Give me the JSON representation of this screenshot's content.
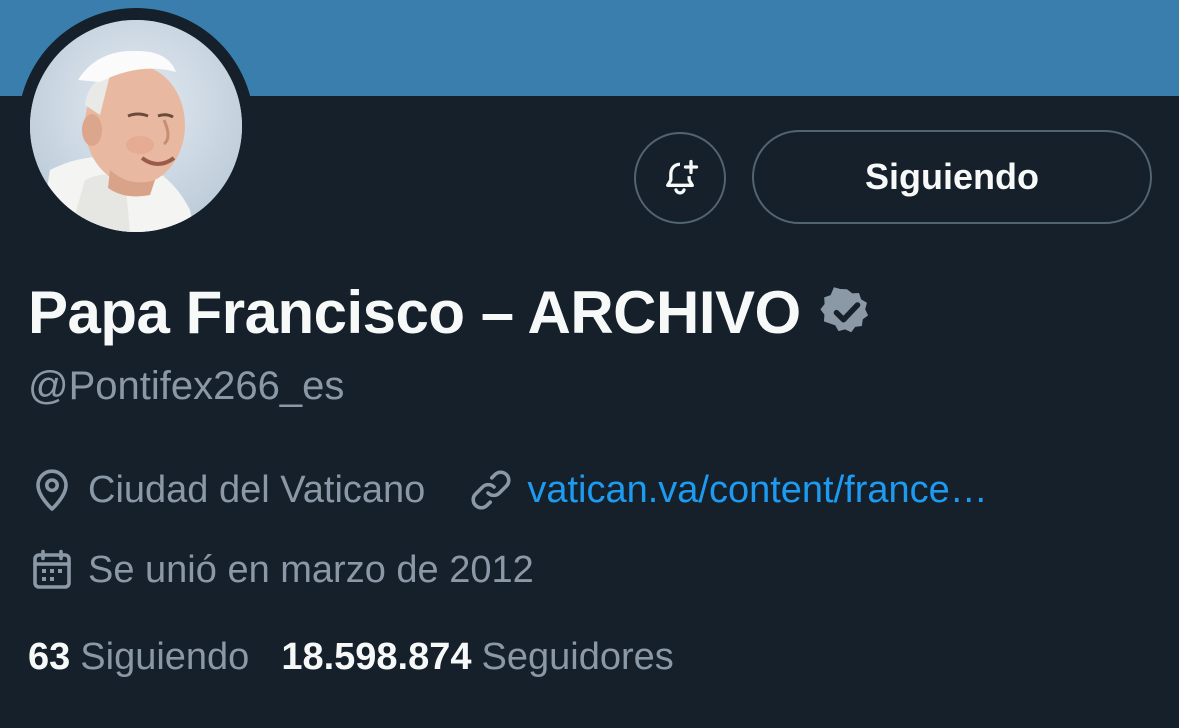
{
  "colors": {
    "background": "#15202b",
    "banner": "#3a7eae",
    "primary_text": "#f7f9f9",
    "secondary_text": "#8b98a5",
    "link": "#1d9bf0",
    "border": "#536471",
    "verified_badge": "#8b98a5"
  },
  "profile": {
    "display_name": "Papa Francisco – ARCHIVO",
    "handle": "@Pontifex266_es",
    "verified_icon": "verified-badge-icon",
    "avatar_icon": "avatar-photo"
  },
  "actions": {
    "notifications_icon": "bell-plus-icon",
    "follow_label": "Siguiendo"
  },
  "meta": {
    "location_icon": "location-pin-icon",
    "location": "Ciudad del Vaticano",
    "link_icon": "link-icon",
    "website": "vatican.va/content/france…",
    "calendar_icon": "calendar-icon",
    "joined": "Se unió en marzo de 2012"
  },
  "stats": {
    "following_count": "63",
    "following_label": "Siguiendo",
    "followers_count": "18.598.874",
    "followers_label": "Seguidores"
  }
}
